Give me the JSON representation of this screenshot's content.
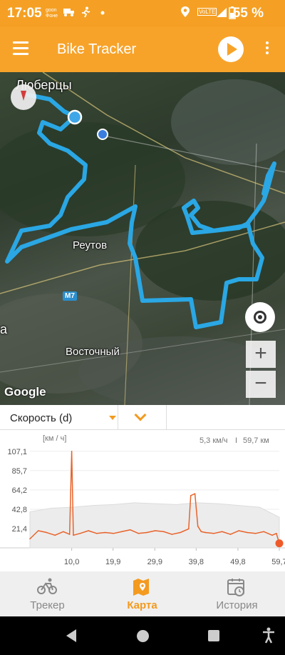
{
  "status_bar": {
    "time": "17:05",
    "notification_text": "goon Фонe",
    "volte_label": "VoLTE",
    "battery_percent": "55 %"
  },
  "app_bar": {
    "title": "Bike Tracker"
  },
  "map": {
    "labels": {
      "lyubertsy": "Люберцы",
      "reutov": "Реутов",
      "vostochny": "Восточный",
      "road_m7": "M7",
      "edge_a": "a"
    },
    "google_logo": "Google",
    "zoom_in": "+",
    "zoom_out": "−",
    "colors": {
      "track": "#2aa7e4",
      "position": "#3fa6e8"
    }
  },
  "chart_controls": {
    "metric": "Скорость (d)"
  },
  "chart_data": {
    "type": "line",
    "unit_label": "[км / ч]",
    "stats": {
      "speed": "5,3 км/ч",
      "separator": "I",
      "distance": "59,7 км"
    },
    "y_ticks": [
      "107,1",
      "85,7",
      "64,2",
      "42,8",
      "21,4"
    ],
    "x_ticks": [
      "10,0",
      "19,9",
      "29,9",
      "39,8",
      "49,8",
      "59,7"
    ],
    "ylim": [
      0,
      107.1
    ],
    "xlim": [
      0,
      59.7
    ],
    "series": [
      {
        "color": "#e8632b",
        "x": [
          0,
          2,
          4,
          6,
          8,
          9.5,
          10.0,
          10.4,
          12,
          14,
          16,
          18,
          20,
          22,
          24,
          26,
          28,
          30,
          32,
          34,
          36,
          38,
          38.5,
          39.5,
          40.2,
          41,
          42,
          44,
          46,
          48,
          50,
          52,
          54,
          56,
          58,
          59,
          59.7
        ],
        "values": [
          10,
          19,
          17,
          14,
          18,
          15,
          107,
          14,
          16,
          19,
          16,
          17,
          16,
          18,
          20,
          16,
          17,
          19,
          18,
          15,
          17,
          21,
          58,
          60,
          24,
          18,
          17,
          16,
          18,
          15,
          19,
          17,
          16,
          18,
          14,
          16,
          5
        ]
      },
      {
        "color": "#d9d9d9",
        "x": [
          0,
          5,
          10,
          15,
          20,
          25,
          30,
          35,
          40,
          45,
          50,
          55,
          59.7
        ],
        "values": [
          40,
          44,
          45,
          47,
          48,
          50,
          49,
          48,
          50,
          49,
          47,
          45,
          34
        ]
      }
    ]
  },
  "bottom_nav": {
    "items": [
      {
        "label": "Трекер"
      },
      {
        "label": "Карта"
      },
      {
        "label": "История"
      }
    ]
  }
}
